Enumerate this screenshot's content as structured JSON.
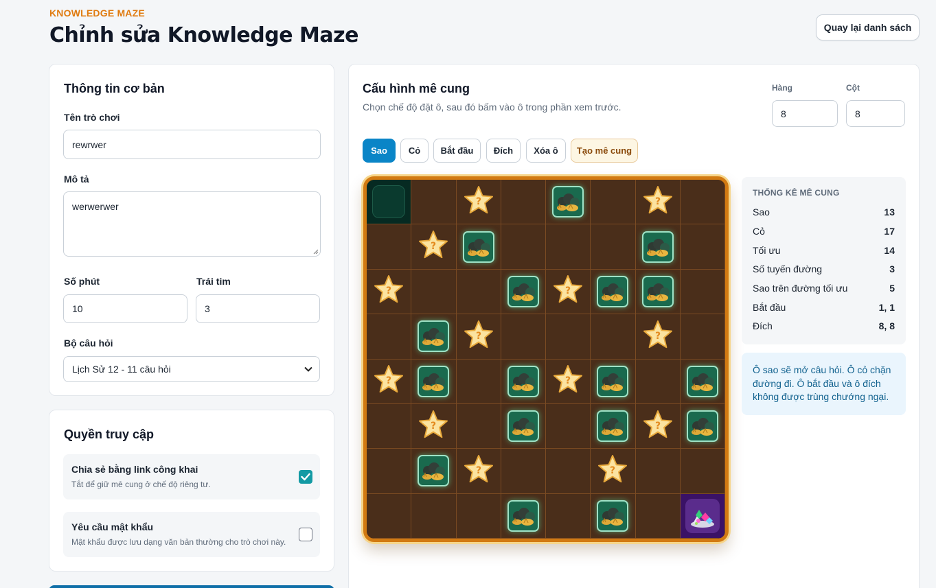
{
  "header": {
    "eyebrow": "KNOWLEDGE MAZE",
    "title": "Chỉnh sửa Knowledge Maze",
    "back_label": "Quay lại danh sách"
  },
  "basic": {
    "title": "Thông tin cơ bản",
    "name_label": "Tên trò chơi",
    "name_value": "rewrwer",
    "desc_label": "Mô tả",
    "desc_value": "werwerwer",
    "minutes_label": "Số phút",
    "minutes_value": "10",
    "hearts_label": "Trái tim",
    "hearts_value": "3",
    "qset_label": "Bộ câu hỏi",
    "qset_value": "Lịch Sử 12 - 11 câu hỏi"
  },
  "access": {
    "title": "Quyền truy cập",
    "public": {
      "title": "Chia sẻ bằng link công khai",
      "desc": "Tắt để giữ mê cung ở chế độ riêng tư.",
      "checked": true
    },
    "password": {
      "title": "Yêu cầu mật khẩu",
      "desc": "Mật khẩu được lưu dạng văn bản thường cho trò chơi này.",
      "checked": false
    }
  },
  "maze": {
    "title": "Cấu hình mê cung",
    "subtitle": "Chọn chế độ đặt ô, sau đó bấm vào ô trong phần xem trước.",
    "rows_label": "Hàng",
    "rows_value": "8",
    "cols_label": "Cột",
    "cols_value": "8",
    "modes": [
      "Sao",
      "Cỏ",
      "Bắt đầu",
      "Đích",
      "Xóa ô",
      "Tạo mê cung"
    ],
    "active_mode": "Sao",
    "grid": [
      [
        "S",
        "",
        "*",
        "",
        "G",
        "",
        "*",
        ""
      ],
      [
        "",
        "*",
        "G",
        "",
        "",
        "",
        "G",
        ""
      ],
      [
        "*",
        "",
        "",
        "G",
        "*",
        "G",
        "G",
        ""
      ],
      [
        "",
        "G",
        "*",
        "",
        "",
        "",
        "*",
        ""
      ],
      [
        "*",
        "G",
        "",
        "G",
        "*",
        "G",
        "",
        "G"
      ],
      [
        "",
        "*",
        "",
        "G",
        "",
        "G",
        "*",
        "G"
      ],
      [
        "",
        "G",
        "*",
        "",
        "",
        "*",
        "",
        ""
      ],
      [
        "",
        "",
        "",
        "G",
        "",
        "G",
        "",
        "E"
      ]
    ],
    "icons": {
      "star": "star-question-icon",
      "grass": "grass-bush-icon",
      "start": "start-marker",
      "goal": "treasure-gems-icon"
    }
  },
  "stats": {
    "title": "THỐNG KÊ MÊ CUNG",
    "rows": [
      {
        "label": "Sao",
        "value": "13"
      },
      {
        "label": "Cỏ",
        "value": "17"
      },
      {
        "label": "Tối ưu",
        "value": "14"
      },
      {
        "label": "Số tuyến đường",
        "value": "3"
      },
      {
        "label": "Sao trên đường tối ưu",
        "value": "5"
      },
      {
        "label": "Bắt đầu",
        "value": "1, 1"
      },
      {
        "label": "Đích",
        "value": "8, 8"
      }
    ]
  },
  "note": "Ô sao sẽ mở câu hỏi. Ô cỏ chặn đường đi. Ô bắt đầu và ô đích không được trùng chướng ngại.",
  "colors": {
    "accent": "#0a85c7",
    "eyebrow": "#e07b10",
    "board_border": "#d27a12",
    "cell": "#4a2e1a",
    "checkbox": "#139aa4"
  }
}
